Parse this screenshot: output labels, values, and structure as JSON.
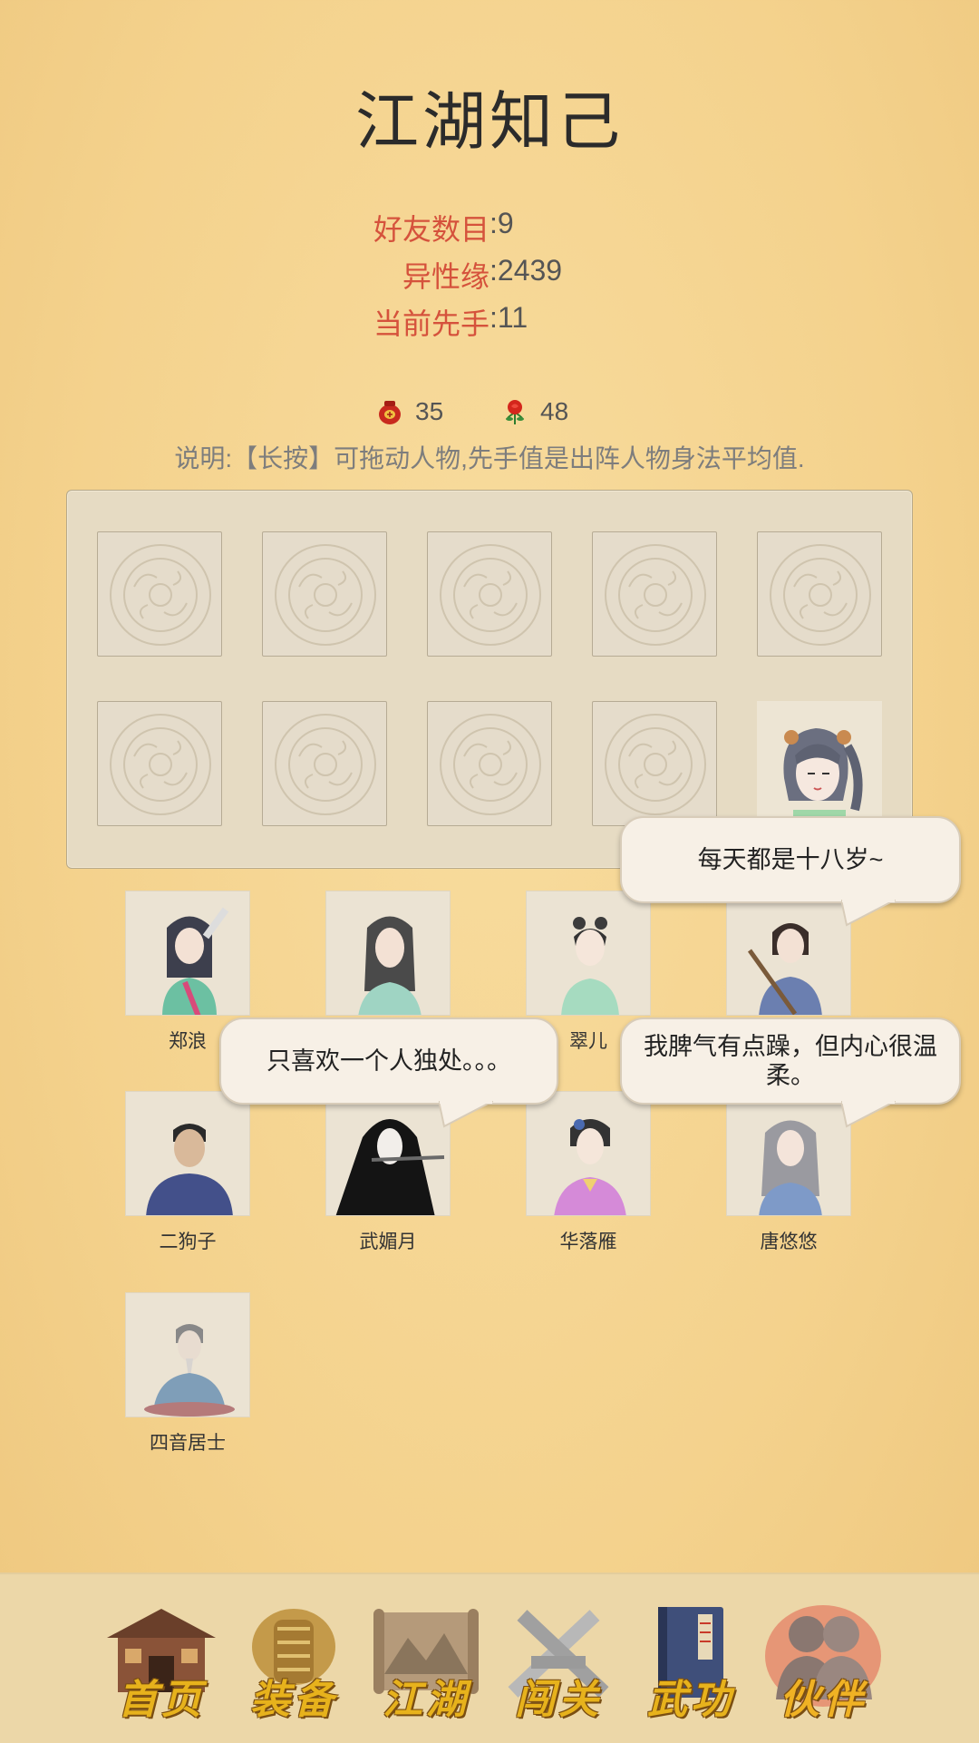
{
  "title": "江湖知己",
  "stats": [
    {
      "label": "好友数目",
      "sep": ":",
      "value": "9"
    },
    {
      "label": "异性缘",
      "sep": ":",
      "value": "2439"
    },
    {
      "label": "当前先手",
      "sep": ":",
      "value": "11"
    }
  ],
  "resources": {
    "wine": {
      "icon": "wine-jar-icon",
      "value": "35"
    },
    "rose": {
      "icon": "rose-icon",
      "value": "48"
    }
  },
  "note": "说明:【长按】可拖动人物,先手值是出阵人物身法平均值.",
  "formation": {
    "slots_total": 10,
    "occupied_slot_character": "girl-twin-tails"
  },
  "characters": [
    {
      "name": "郑浪",
      "icon": "swordsman-portrait"
    },
    {
      "name": "",
      "icon": "scholar-portrait"
    },
    {
      "name": "翠儿",
      "icon": "maid-portrait"
    },
    {
      "name": "",
      "icon": "young-swordsman-portrait"
    },
    {
      "name": "二狗子",
      "icon": "peasant-portrait"
    },
    {
      "name": "武媚月",
      "icon": "flute-lady-portrait"
    },
    {
      "name": "华落雁",
      "icon": "lady-purple-portrait"
    },
    {
      "name": "唐悠悠",
      "icon": "lady-grey-portrait"
    },
    {
      "name": "四音居士",
      "icon": "hermit-portrait"
    }
  ],
  "bubbles": [
    {
      "text": "每天都是十八岁~"
    },
    {
      "text": "只喜欢一个人独处。。。"
    },
    {
      "text": "我脾气有点躁，但内心很温柔。"
    }
  ],
  "nav": [
    {
      "label": "首页",
      "icon": "home-icon"
    },
    {
      "label": "装备",
      "icon": "armor-icon"
    },
    {
      "label": "江湖",
      "icon": "scroll-map-icon"
    },
    {
      "label": "闯关",
      "icon": "crossed-swords-icon"
    },
    {
      "label": "武功",
      "icon": "martial-book-icon"
    },
    {
      "label": "伙伴",
      "icon": "partners-icon",
      "active": true
    }
  ],
  "colors": {
    "accent_label": "#d5523c",
    "nav_label": "#e7b21c",
    "active_glow": "#e0463a"
  }
}
